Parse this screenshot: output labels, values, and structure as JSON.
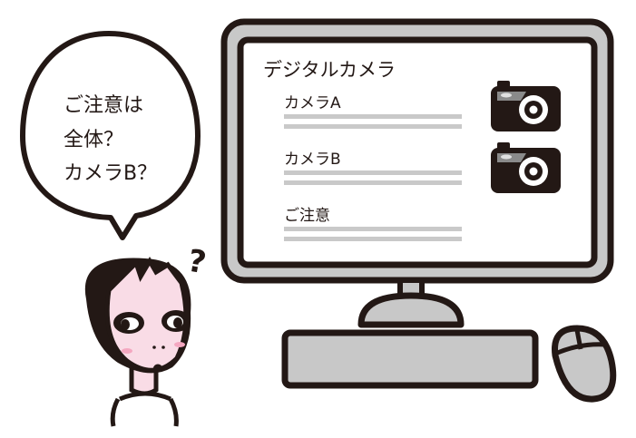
{
  "screen": {
    "title": "デジタルカメラ",
    "sections": [
      {
        "heading": "カメラA",
        "has_camera": true
      },
      {
        "heading": "カメラB",
        "has_camera": true
      },
      {
        "heading": "ご注意",
        "has_camera": false
      }
    ]
  },
  "speech_bubble": {
    "lines": [
      "ご注意は",
      "全体？",
      "カメラB？"
    ]
  },
  "question_mark": "?",
  "colors": {
    "ink": "#231815",
    "bezel_gray": "#c8c8c8",
    "text_line_gray": "#c9c9c9",
    "skin": "#f9dce6",
    "cheek": "#f4a7c0"
  }
}
